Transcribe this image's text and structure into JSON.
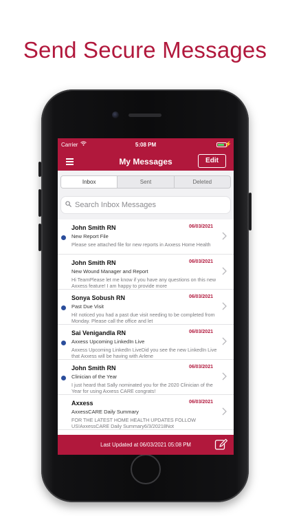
{
  "headline": "Send Secure Messages",
  "status_bar": {
    "carrier": "Carrier",
    "time": "5:08 PM",
    "battery_color": "#4cd964"
  },
  "nav": {
    "title": "My Messages",
    "edit_label": "Edit"
  },
  "tabs": [
    {
      "label": "Inbox",
      "active": true
    },
    {
      "label": "Sent",
      "active": false
    },
    {
      "label": "Deleted",
      "active": false
    }
  ],
  "search": {
    "placeholder": "Search Inbox Messages"
  },
  "messages": [
    {
      "sender": "John Smith RN",
      "date": "06/03/2021",
      "subject": "New Report File",
      "preview": "Please see attached file for new reports in Axxess Home Health",
      "unread": true
    },
    {
      "sender": "John Smith RN",
      "date": "06/03/2021",
      "subject": "New Wound Manager and Report",
      "preview": "Hi TeamPlease let me know if you have any questions on this new Axxess feature! I am happy to provide more",
      "unread": false
    },
    {
      "sender": "Sonya Sobush RN",
      "date": "06/03/2021",
      "subject": "Past Due Visit",
      "preview": "Hi! noticed you had a past due visit needing to be completed from Monday. Please call the office and let",
      "unread": true
    },
    {
      "sender": "Sai Venigandla RN",
      "date": "06/03/2021",
      "subject": "Axxess Upcoming LinkedIn Live",
      "preview": "Axxess Upcoming LinkedIn LiveDid you see the new LinkedIn Live that Axxess will be having with Arlene",
      "unread": true
    },
    {
      "sender": "John Smith RN",
      "date": "06/03/2021",
      "subject": "Clinician of the Year",
      "preview": "I just heard that Sally nominated you for the 2020 Clinician of the Year for using Axxess CARE congrats!",
      "unread": true
    },
    {
      "sender": "Axxess",
      "date": "06/03/2021",
      "subject": "AxxessCARE Daily Summary",
      "preview": "FOR THE LATEST HOME HEALTH UPDATES FOLLOW US!AxxessCARE Daily Summary6/3/20218Not",
      "unread": false
    }
  ],
  "footer": {
    "last_updated": "Last Updated at 06/03/2021 05:08 PM"
  },
  "colors": {
    "brand": "#b1183c",
    "unread_dot": "#2a4d9b"
  }
}
